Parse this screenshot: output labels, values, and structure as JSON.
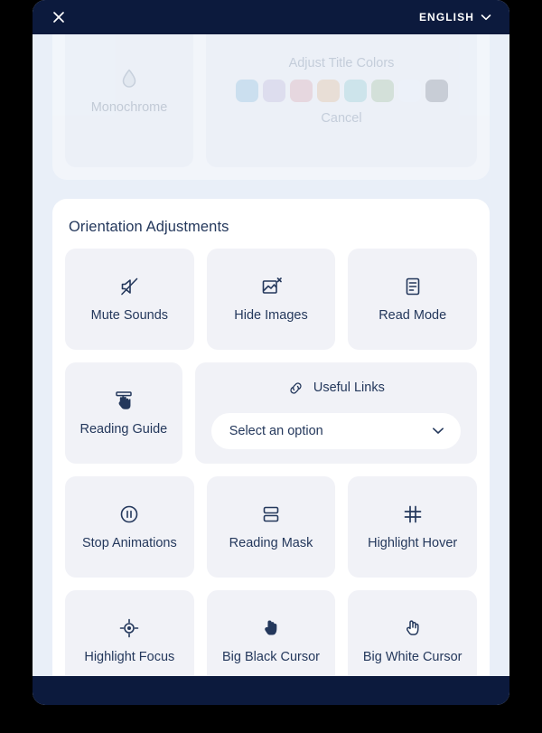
{
  "header": {
    "close_icon": "close-icon",
    "language_label": "ENGLISH",
    "language_chevron_icon": "chevron-down-icon"
  },
  "faded_section": {
    "monochrome": {
      "label": "Monochrome",
      "icon": "droplet-icon"
    },
    "title_colors": {
      "label": "Adjust Title Colors",
      "cancel_label": "Cancel",
      "swatches": [
        {
          "name": "swatch-blue",
          "color": "#a4cbe4"
        },
        {
          "name": "swatch-lavender",
          "color": "#cdc5e2"
        },
        {
          "name": "swatch-pink",
          "color": "#e3b8bd"
        },
        {
          "name": "swatch-peach",
          "color": "#e8c8a9"
        },
        {
          "name": "swatch-teal",
          "color": "#a8d7da"
        },
        {
          "name": "swatch-sage",
          "color": "#b7cdb0"
        },
        {
          "name": "swatch-white",
          "color": "#f2f5fb"
        },
        {
          "name": "swatch-gray",
          "color": "#9ca0a8"
        }
      ]
    }
  },
  "orientation": {
    "title": "Orientation Adjustments",
    "rows": [
      {
        "tiles": [
          {
            "label": "Mute Sounds",
            "icon": "mute-sounds-icon",
            "name": "mute-sounds"
          },
          {
            "label": "Hide Images",
            "icon": "hide-images-icon",
            "name": "hide-images"
          },
          {
            "label": "Read Mode",
            "icon": "read-mode-icon",
            "name": "read-mode"
          }
        ]
      },
      {
        "tiles": [
          {
            "label": "Reading Guide",
            "icon": "reading-guide-icon",
            "name": "reading-guide"
          }
        ],
        "useful_links": {
          "label": "Useful Links",
          "icon": "link-icon",
          "select_value": "Select an option",
          "chevron_icon": "chevron-down-icon"
        }
      },
      {
        "tiles": [
          {
            "label": "Stop Animations",
            "icon": "pause-circle-icon",
            "name": "stop-animations"
          },
          {
            "label": "Reading Mask",
            "icon": "reading-mask-icon",
            "name": "reading-mask"
          },
          {
            "label": "Highlight Hover",
            "icon": "highlight-hover-icon",
            "name": "highlight-hover"
          }
        ]
      },
      {
        "tiles": [
          {
            "label": "Highlight Focus",
            "icon": "highlight-focus-icon",
            "name": "highlight-focus"
          },
          {
            "label": "Big Black Cursor",
            "icon": "big-black-cursor-icon",
            "name": "big-black-cursor"
          },
          {
            "label": "Big White Cursor",
            "icon": "big-white-cursor-icon",
            "name": "big-white-cursor"
          }
        ]
      }
    ]
  },
  "colors": {
    "header_navy": "#0c1a3d",
    "modal_bg": "#e9eff8",
    "card_white": "#ffffff",
    "tile_bg": "#f1f2f7",
    "text_navy": "#24385c",
    "page_bg": "#000000"
  }
}
